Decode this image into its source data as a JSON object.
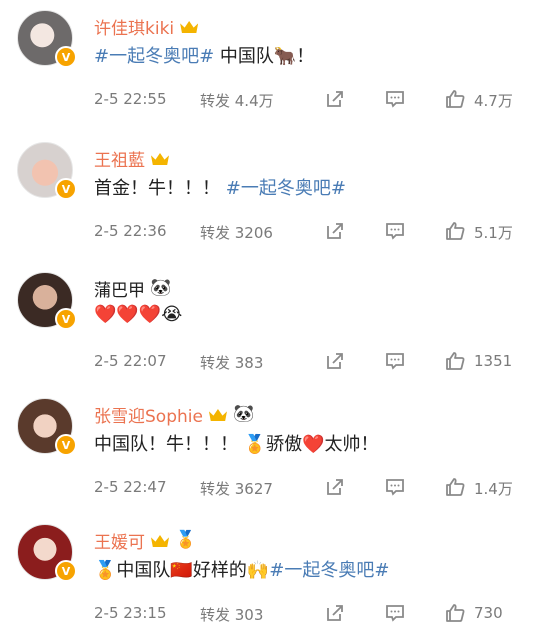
{
  "comments": [
    {
      "username": "许佳琪kiki",
      "badges": [
        "crown"
      ],
      "text_topic": "#一起冬奥吧#",
      "text_rest": " 中国队🐂！",
      "time": "2-5 22:55",
      "repost": "转发 4.4万",
      "likes": "4.7万"
    },
    {
      "username": "王祖藍",
      "badges": [
        "crown"
      ],
      "text_main": "首金！牛！！！",
      "text_topic": "#一起冬奥吧#",
      "time": "2-5 22:36",
      "repost": "转发 3206",
      "likes": "5.1万"
    },
    {
      "username": "蒲巴甲",
      "badges": [
        "panda"
      ],
      "text_main": "❤️❤️❤️😭",
      "time": "2-5 22:07",
      "repost": "转发 383",
      "likes": "1351"
    },
    {
      "username": "张雪迎Sophie",
      "badges": [
        "crown",
        "panda"
      ],
      "text_main": "中国队！牛！！！ 🏅骄傲❤️太帅！",
      "time": "2-5 22:47",
      "repost": "转发 3627",
      "likes": "1.4万"
    },
    {
      "username": "王媛可",
      "badges": [
        "crown",
        "medal"
      ],
      "text_main": "🏅中国队🇨🇳好样的🙌",
      "text_topic": "#一起冬奥吧#",
      "time": "2-5 23:15",
      "repost": "转发 303",
      "likes": "730"
    }
  ],
  "icons": {
    "share": "share-icon",
    "comment": "comment-icon",
    "like": "like-icon"
  },
  "colors": {
    "username": "#eb7350",
    "topic": "#4a7cb5",
    "meta": "#7a7a7a",
    "verified": "#f7a300"
  }
}
